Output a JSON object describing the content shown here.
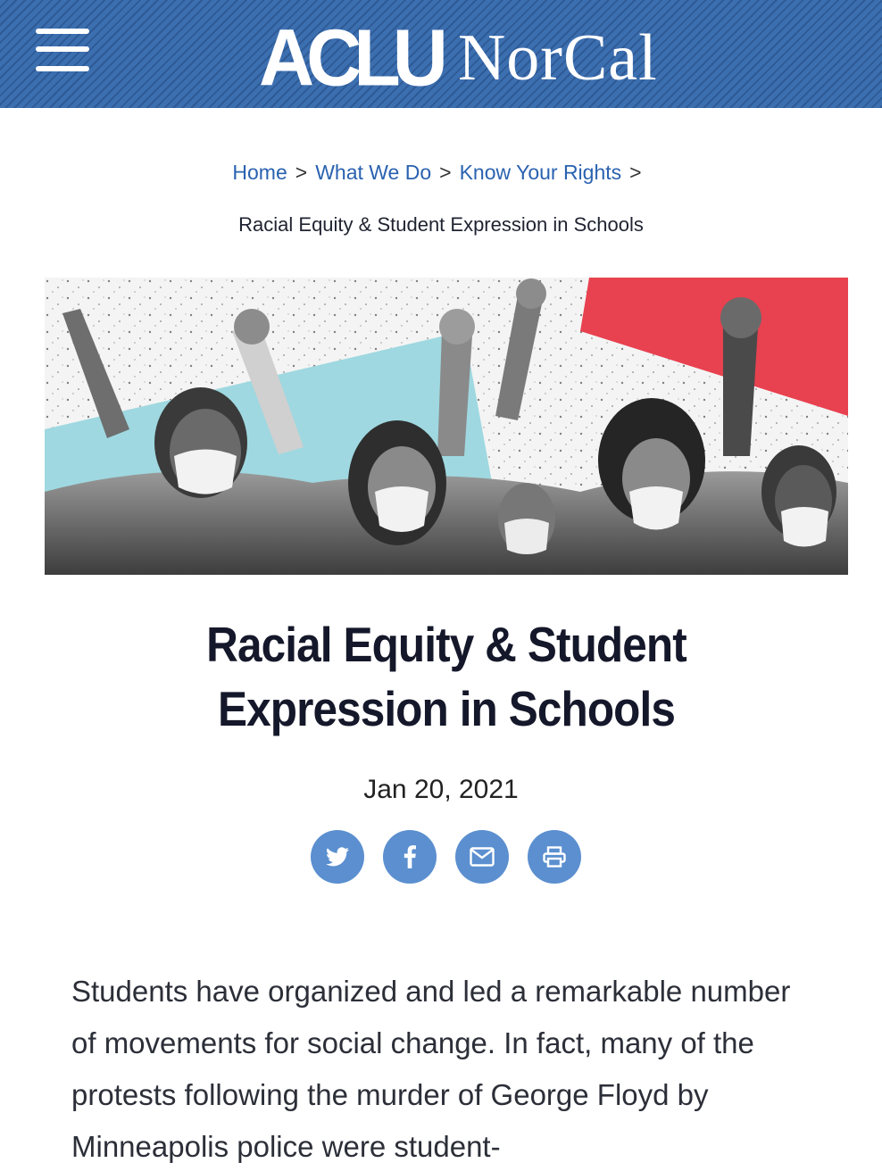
{
  "header": {
    "logo_primary": "ACLU",
    "logo_secondary": "NorCal",
    "colors": {
      "background": "#3c6fb0",
      "text": "#ffffff"
    },
    "menu_icon": "hamburger-menu-icon"
  },
  "breadcrumb": {
    "items": [
      "Home",
      "What We Do",
      "Know Your Rights"
    ],
    "separator": ">",
    "current": "Racial Equity & Student Expression in Schools",
    "link_color": "#2a62b0"
  },
  "hero": {
    "description_colors": {
      "teal_band": "#9fd8e0",
      "red_band": "#e8414f"
    }
  },
  "article": {
    "title_line1": "Racial Equity & Student",
    "title_line2": "Expression in Schools",
    "date": "Jan 20, 2021",
    "share": [
      {
        "icon": "twitter-icon"
      },
      {
        "icon": "facebook-icon"
      },
      {
        "icon": "email-icon"
      },
      {
        "icon": "print-icon"
      }
    ],
    "share_color": "#5b8fcf",
    "body": "Students have organized and led a remarkable number of movements for social change. In fact, many of the protests following the murder of George Floyd by Minneapolis police were student-"
  }
}
